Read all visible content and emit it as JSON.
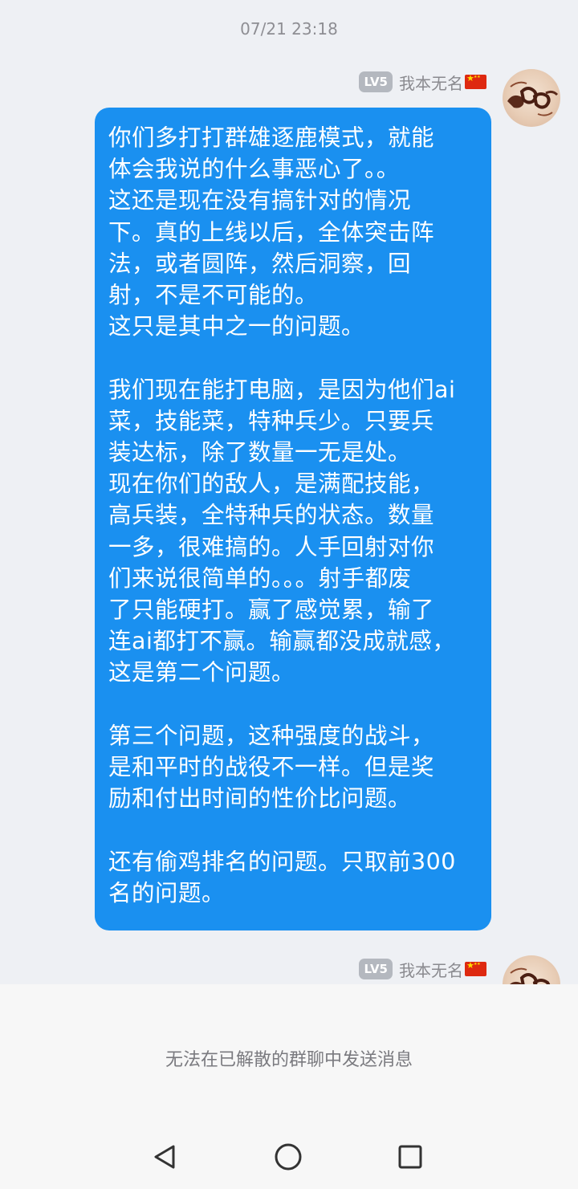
{
  "chat": {
    "timestamp": "07/21 23:18",
    "messages": [
      {
        "sender": {
          "level": "LV5",
          "name": "我本无名",
          "flag": "china-flag-icon"
        },
        "text": "你们多打打群雄逐鹿模式，就能\n体会我说的什么事恶心了。。\n这还是现在没有搞针对的情况\n下。真的上线以后，全体突击阵\n法，或者圆阵，然后洞察，回\n射，不是不可能的。\n这只是其中之一的问题。\n\n我们现在能打电脑，是因为他们ai\n菜，技能菜，特种兵少。只要兵\n装达标，除了数量一无是处。\n现在你们的敌人，是满配技能，\n高兵装，全特种兵的状态。数量\n一多，很难搞的。人手回射对你\n们来说很简单的。。。射手都废\n了只能硬打。赢了感觉累，输了\n连ai都打不赢。输赢都没成就感，\n这是第二个问题。\n\n第三个问题，这种强度的战斗，\n是和平时的战役不一样。但是奖\n励和付出时间的性价比问题。\n\n还有偷鸡排名的问题。只取前300\n名的问题。"
      },
      {
        "sender": {
          "level": "LV5",
          "name": "我本无名",
          "flag": "china-flag-icon"
        }
      }
    ]
  },
  "bottom_bar": {
    "notice": "无法在已解散的群聊中发送消息"
  },
  "nav": {
    "back": "back-triangle-icon",
    "home": "home-circle-icon",
    "recents": "recents-square-icon"
  },
  "colors": {
    "bubble": "#1a90f0",
    "background": "#eef0f4",
    "badge": "#b4b8bf"
  }
}
